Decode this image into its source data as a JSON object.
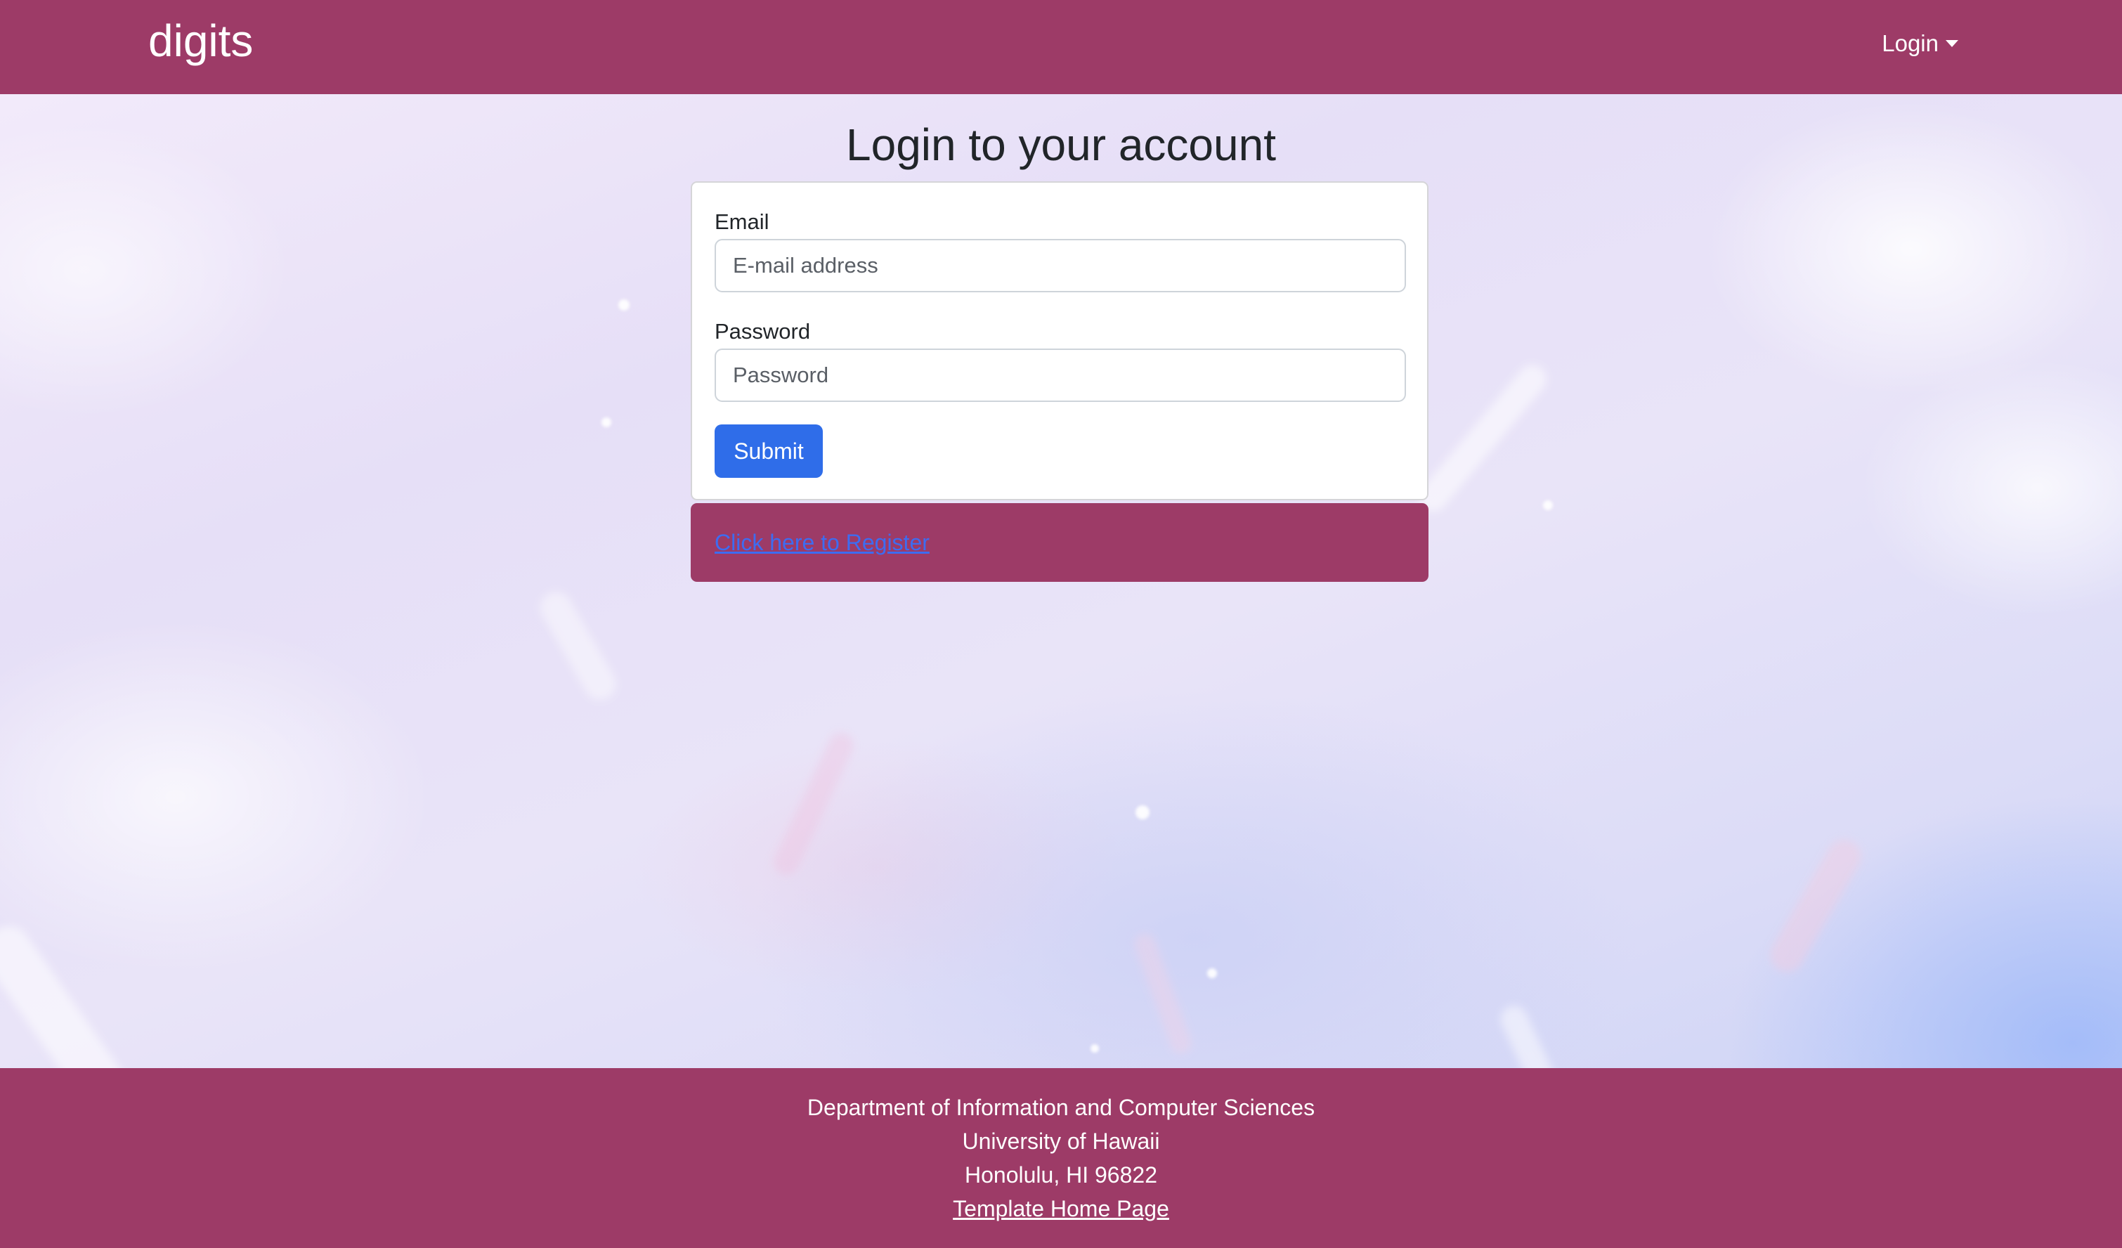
{
  "navbar": {
    "brand": "digits",
    "login_menu": "Login",
    "background_color": "#9d3b67"
  },
  "login": {
    "title": "Login to your account",
    "email_label": "Email",
    "email_placeholder": "E-mail address",
    "email_value": "",
    "password_label": "Password",
    "password_placeholder": "Password",
    "password_value": "",
    "submit_label": "Submit",
    "register_link": "Click here to Register"
  },
  "footer": {
    "lines": [
      "Department of Information and Computer Sciences",
      "University of Hawaii",
      "Honolulu, HI 96822"
    ],
    "link": "Template Home Page"
  },
  "colors": {
    "brand": "#9d3b67",
    "primary_button": "#2f6de9",
    "link": "#3d6cf1"
  },
  "icons": {
    "login_menu": "caret-down-icon"
  }
}
